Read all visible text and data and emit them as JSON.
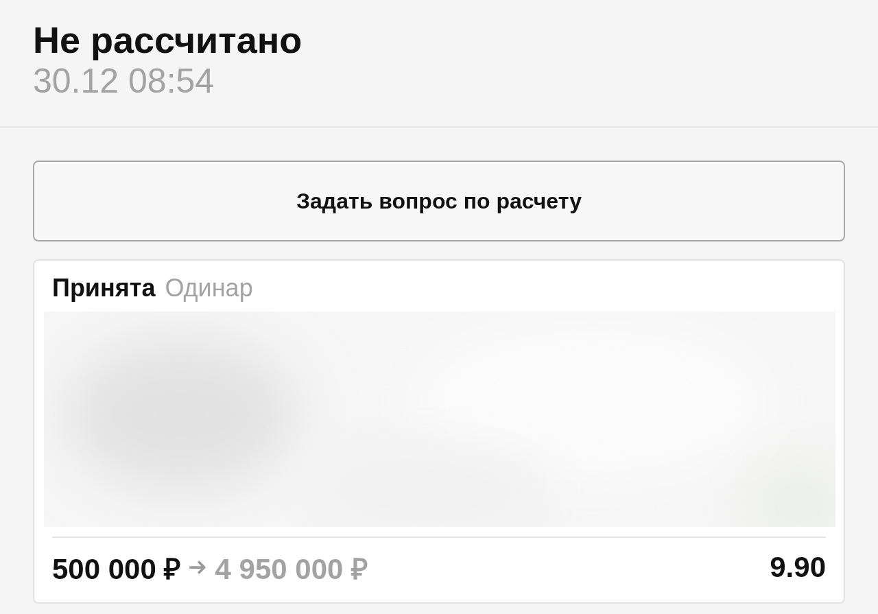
{
  "header": {
    "title": "Не рассчитано",
    "datetime": "30.12 08:54"
  },
  "ask_button": {
    "label": "Задать вопрос по расчету"
  },
  "bet": {
    "status": "Принята",
    "type": "Одинар",
    "stake": "500 000 ₽",
    "payout": "4 950 000 ₽",
    "odds": "9.90"
  }
}
